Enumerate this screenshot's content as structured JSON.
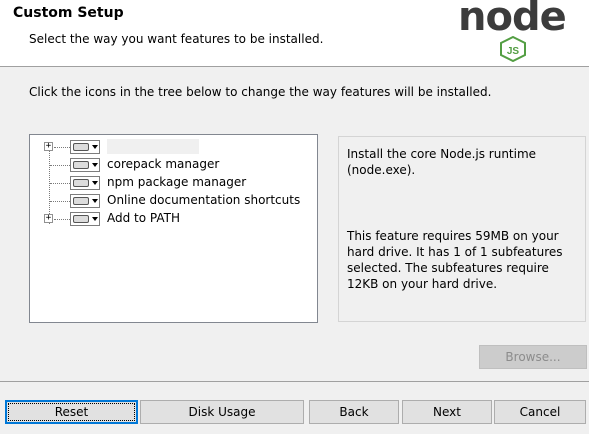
{
  "header": {
    "title": "Custom Setup",
    "subtitle": "Select the way you want features to be installed."
  },
  "logo": {
    "word": "node",
    "badge": "JS",
    "brand_color": "#539e43",
    "text_color": "#3c3c3c"
  },
  "instructions": "Click the icons in the tree below to change the way features will be installed.",
  "tree": {
    "items": [
      {
        "label": "",
        "expandable": true
      },
      {
        "label": "corepack manager",
        "expandable": false
      },
      {
        "label": "npm package manager",
        "expandable": false
      },
      {
        "label": "Online documentation shortcuts",
        "expandable": false
      },
      {
        "label": "Add to PATH",
        "expandable": true
      }
    ]
  },
  "description": {
    "main": "Install the core Node.js runtime (node.exe).",
    "size": "This feature requires 59MB on your hard drive. It has 1 of 1 subfeatures selected. The subfeatures require 12KB on your hard drive."
  },
  "buttons": {
    "browse": "Browse...",
    "reset": "Reset",
    "disk_usage": "Disk Usage",
    "back": "Back",
    "next": "Next",
    "cancel": "Cancel"
  },
  "colors": {
    "focus": "#0078d7",
    "window_bg": "#f0f0f0"
  }
}
